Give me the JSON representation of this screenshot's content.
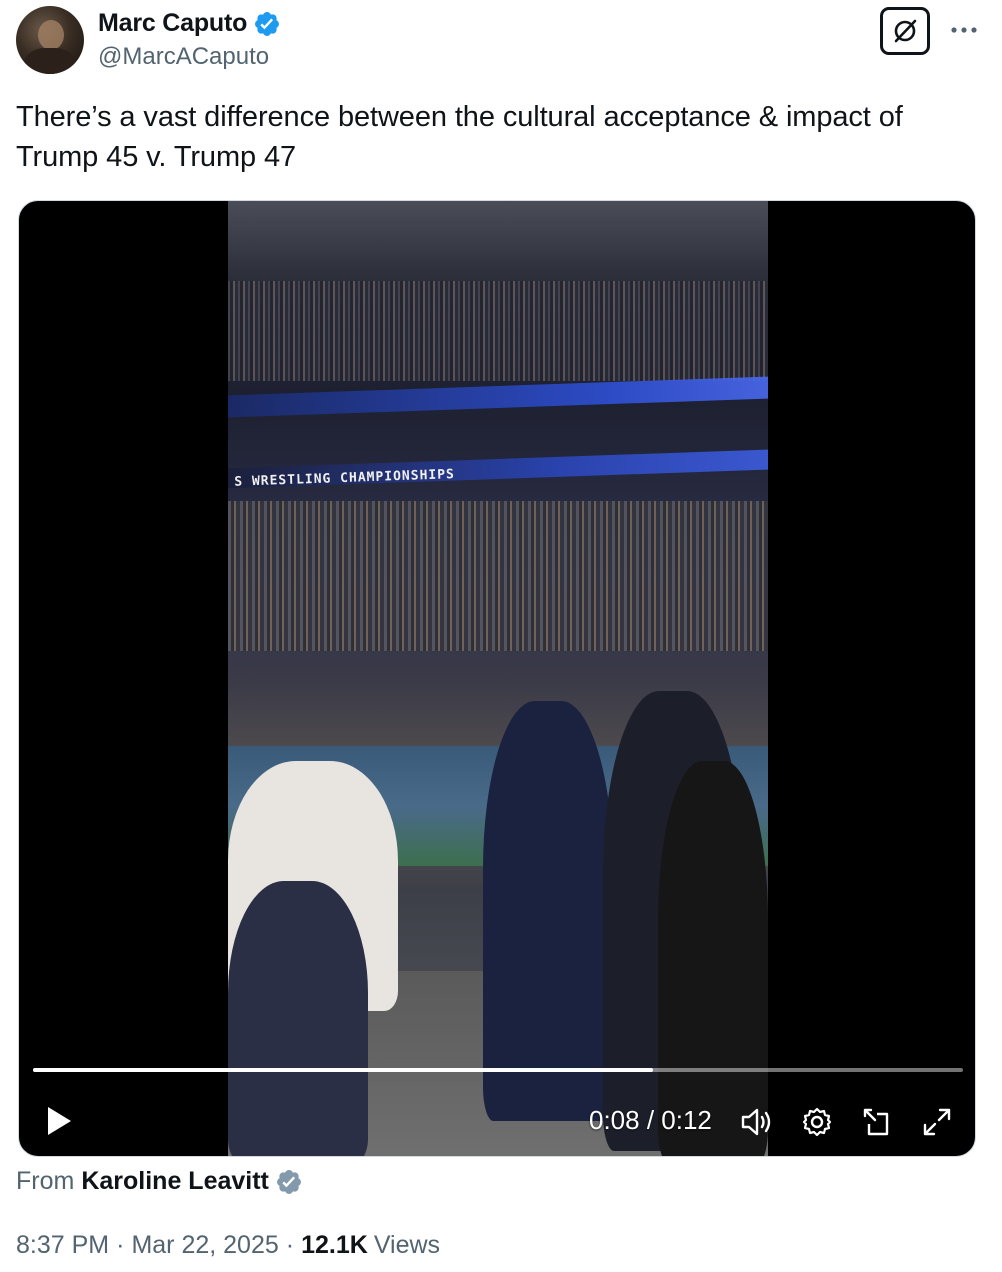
{
  "author": {
    "display_name": "Marc Caputo",
    "handle": "@MarcACaputo",
    "verified_color": "#1d9bf0"
  },
  "actions": {
    "grok_icon": "grok-slash-icon",
    "more_icon": "more-dots-icon"
  },
  "tweet": {
    "text": "There’s a vast difference between the cultural acceptance & impact of Trump 45 v. Trump 47"
  },
  "video": {
    "banner_text": "S WRESTLING CHAMPIONSHIPS",
    "current_time": "0:08",
    "duration": "0:12",
    "time_display": "0:08 / 0:12",
    "progress_fraction": 0.6667,
    "controls": [
      "play-icon",
      "volume-icon",
      "settings-icon",
      "pop-out-icon",
      "fullscreen-icon"
    ]
  },
  "attribution": {
    "from_label": "From",
    "source_name": "Karoline Leavitt",
    "badge_color": "#829aab"
  },
  "meta": {
    "time": "8:37 PM",
    "separator": "·",
    "date": "Mar 22, 2025",
    "views_count": "12.1K",
    "views_label": "Views"
  }
}
